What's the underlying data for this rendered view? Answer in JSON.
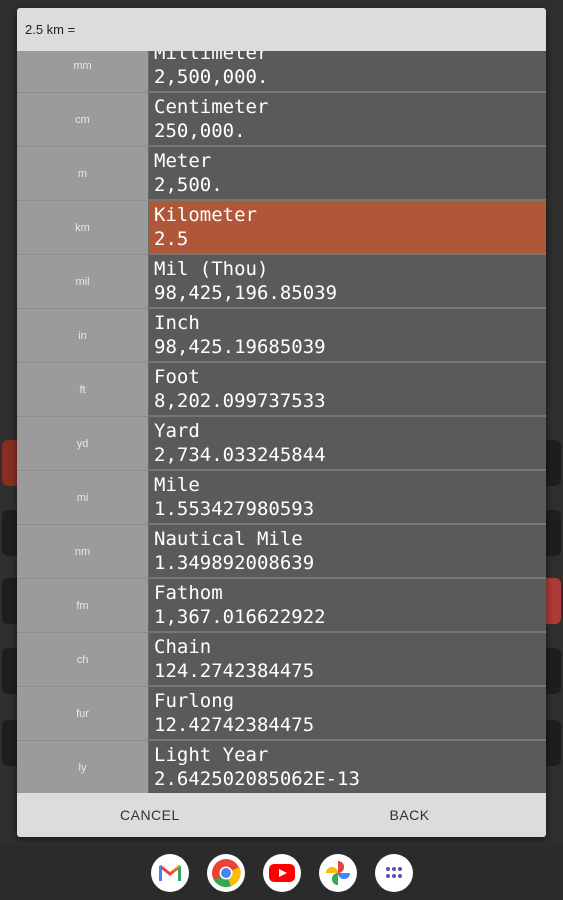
{
  "dialog": {
    "header_text": "2.5 km =",
    "cancel_label": "CANCEL",
    "back_label": "BACK"
  },
  "units": [
    {
      "abbr": "mm",
      "name": "Millimeter",
      "value": "2,500,000."
    },
    {
      "abbr": "cm",
      "name": "Centimeter",
      "value": "250,000."
    },
    {
      "abbr": "m",
      "name": "Meter",
      "value": "2,500."
    },
    {
      "abbr": "km",
      "name": "Kilometer",
      "value": "2.5",
      "selected": true
    },
    {
      "abbr": "mil",
      "name": "Mil (Thou)",
      "value": "98,425,196.85039"
    },
    {
      "abbr": "in",
      "name": "Inch",
      "value": "98,425.19685039"
    },
    {
      "abbr": "ft",
      "name": "Foot",
      "value": "8,202.099737533"
    },
    {
      "abbr": "yd",
      "name": "Yard",
      "value": "2,734.033245844"
    },
    {
      "abbr": "mi",
      "name": "Mile",
      "value": "1.553427980593"
    },
    {
      "abbr": "nm",
      "name": "Nautical Mile",
      "value": "1.349892008639"
    },
    {
      "abbr": "fm",
      "name": "Fathom",
      "value": "1,367.016622922"
    },
    {
      "abbr": "ch",
      "name": "Chain",
      "value": "124.2742384475"
    },
    {
      "abbr": "fur",
      "name": "Furlong",
      "value": "12.42742384475"
    },
    {
      "abbr": "ly",
      "name": "Light Year",
      "value": "2.642502085062E-13"
    }
  ],
  "navbar": {
    "apps": [
      "gmail-icon",
      "chrome-icon",
      "youtube-icon",
      "photos-icon",
      "app-drawer-icon"
    ]
  },
  "colors": {
    "selected_row": "#b0573a",
    "cell_bg": "#5a5a5a",
    "abbr_bg": "#9b9b9b"
  }
}
